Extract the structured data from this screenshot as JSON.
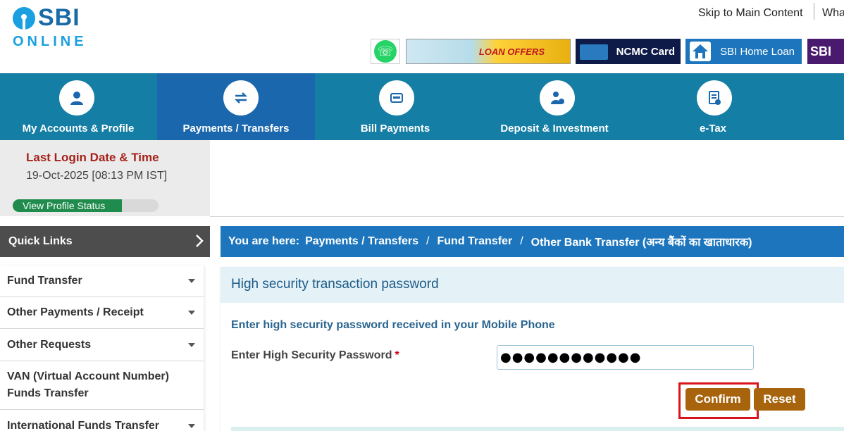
{
  "header": {
    "logo_main": "SBI",
    "logo_sub": "ONLINE",
    "skip_link": "Skip to Main Content",
    "whats_new": "Wha",
    "banners": {
      "loan": "LOAN OFFERS",
      "ncmc": "NCMC Card",
      "home_loan": "SBI Home Loan",
      "sbi": "SBI"
    }
  },
  "nav": {
    "items": [
      {
        "label": "My Accounts & Profile",
        "icon": "user-icon"
      },
      {
        "label": "Payments / Transfers",
        "icon": "transfer-icon",
        "active": true
      },
      {
        "label": "Bill Payments",
        "icon": "bill-icon"
      },
      {
        "label": "Deposit & Investment",
        "icon": "investment-icon"
      },
      {
        "label": "e-Tax",
        "icon": "tax-document-icon"
      }
    ]
  },
  "login": {
    "title": "Last Login Date & Time",
    "time": "19-Oct-2025 [08:13 PM IST]",
    "profile_status": "View Profile Status",
    "profile_progress": 0.75
  },
  "quick_links": {
    "title": "Quick Links",
    "items": [
      {
        "label": "Fund Transfer"
      },
      {
        "label": "Other Payments / Receipt"
      },
      {
        "label": "Other Requests"
      },
      {
        "label": "VAN (Virtual Account Number) Funds Transfer"
      },
      {
        "label": "International Funds Transfer"
      }
    ]
  },
  "breadcrumb": {
    "lead": "You are here:",
    "items": [
      "Payments / Transfers",
      "Fund Transfer",
      "Other Bank Transfer (अन्य बैंकों का खाताधारक)"
    ],
    "separator": "/"
  },
  "form": {
    "title": "High security transaction password",
    "instruction": "Enter high security password received in your Mobile Phone",
    "field_label": "Enter High Security Password",
    "required_mark": "*",
    "password_value": "●●●●●●●●●●●●",
    "confirm_label": "Confirm",
    "reset_label": "Reset"
  },
  "colors": {
    "nav_bg": "#147ea4",
    "nav_active": "#1b67ad",
    "button": "#a8640c",
    "highlight": "#d9141c",
    "login_title": "#a5221a"
  }
}
